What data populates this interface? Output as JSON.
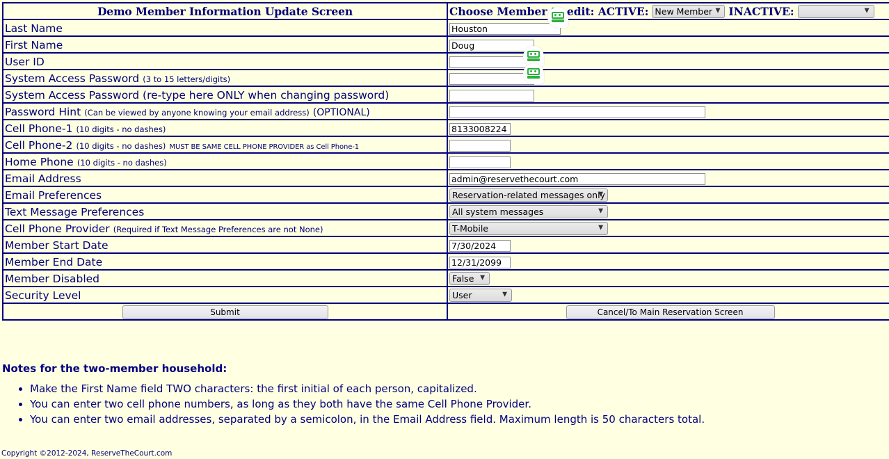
{
  "header": {
    "title": "Demo Member Information Update Screen",
    "choose_member_label": "Choose Member to edit: ACTIVE:",
    "active_select_value": "New Member",
    "inactive_label": "INACTIVE:",
    "inactive_select_value": ""
  },
  "fields": {
    "last_name": {
      "label": "Last Name",
      "value": "Houston"
    },
    "first_name": {
      "label": "First Name",
      "value": "Doug"
    },
    "user_id": {
      "label": "User ID",
      "value": ""
    },
    "password": {
      "label": "System Access Password",
      "hint": "(3 to 15 letters/digits)",
      "value": ""
    },
    "password_retype": {
      "label": "System Access Password (re-type here ONLY when changing password)",
      "value": ""
    },
    "password_hint": {
      "label": "Password Hint",
      "hint": "(Can be viewed by anyone knowing your email address)",
      "optional": "(OPTIONAL)",
      "value": ""
    },
    "cell_phone_1": {
      "label": "Cell Phone-1",
      "hint": "(10 digits - no dashes)",
      "value": "8133008224"
    },
    "cell_phone_2": {
      "label": "Cell Phone-2",
      "hint": "(10 digits - no dashes)",
      "note": "MUST BE SAME CELL PHONE PROVIDER as Cell Phone-1",
      "value": ""
    },
    "home_phone": {
      "label": "Home Phone",
      "hint": "(10 digits - no dashes)",
      "value": ""
    },
    "email_address": {
      "label": "Email Address",
      "value": "admin@reservethecourt.com"
    },
    "email_preferences": {
      "label": "Email Preferences",
      "value": "Reservation-related messages only"
    },
    "text_message_preferences": {
      "label": "Text Message Preferences",
      "value": "All system messages"
    },
    "cell_phone_provider": {
      "label": "Cell Phone Provider",
      "hint": "(Required if Text Message Preferences are not None)",
      "value": "T-Mobile"
    },
    "member_start_date": {
      "label": "Member Start Date",
      "value": "7/30/2024"
    },
    "member_end_date": {
      "label": "Member End Date",
      "value": "12/31/2099"
    },
    "member_disabled": {
      "label": "Member Disabled",
      "value": "False"
    },
    "security_level": {
      "label": "Security Level",
      "value": "User"
    }
  },
  "buttons": {
    "submit": "Submit",
    "cancel": "Cancel/To Main Reservation Screen"
  },
  "notes": {
    "heading": "Notes for the two-member household:",
    "items": [
      "Make the First Name field TWO characters: the first initial of each person, capitalized.",
      "You can enter two cell phone numbers, as long as they both have the same Cell Phone Provider.",
      "You can enter two email addresses, separated by a semicolon, in the Email Address field. Maximum length is 50 characters total."
    ]
  },
  "footer": {
    "copyright": "Copyright ©2012-2024, ReserveTheCourt.com"
  },
  "colors": {
    "text_navy": "#000080",
    "page_background": "#FFFFE1",
    "border": "#000080",
    "badge_green": "#2FAF3F"
  },
  "badges": {
    "icon_name": "password-autofill-badge-icon",
    "count": 3
  }
}
